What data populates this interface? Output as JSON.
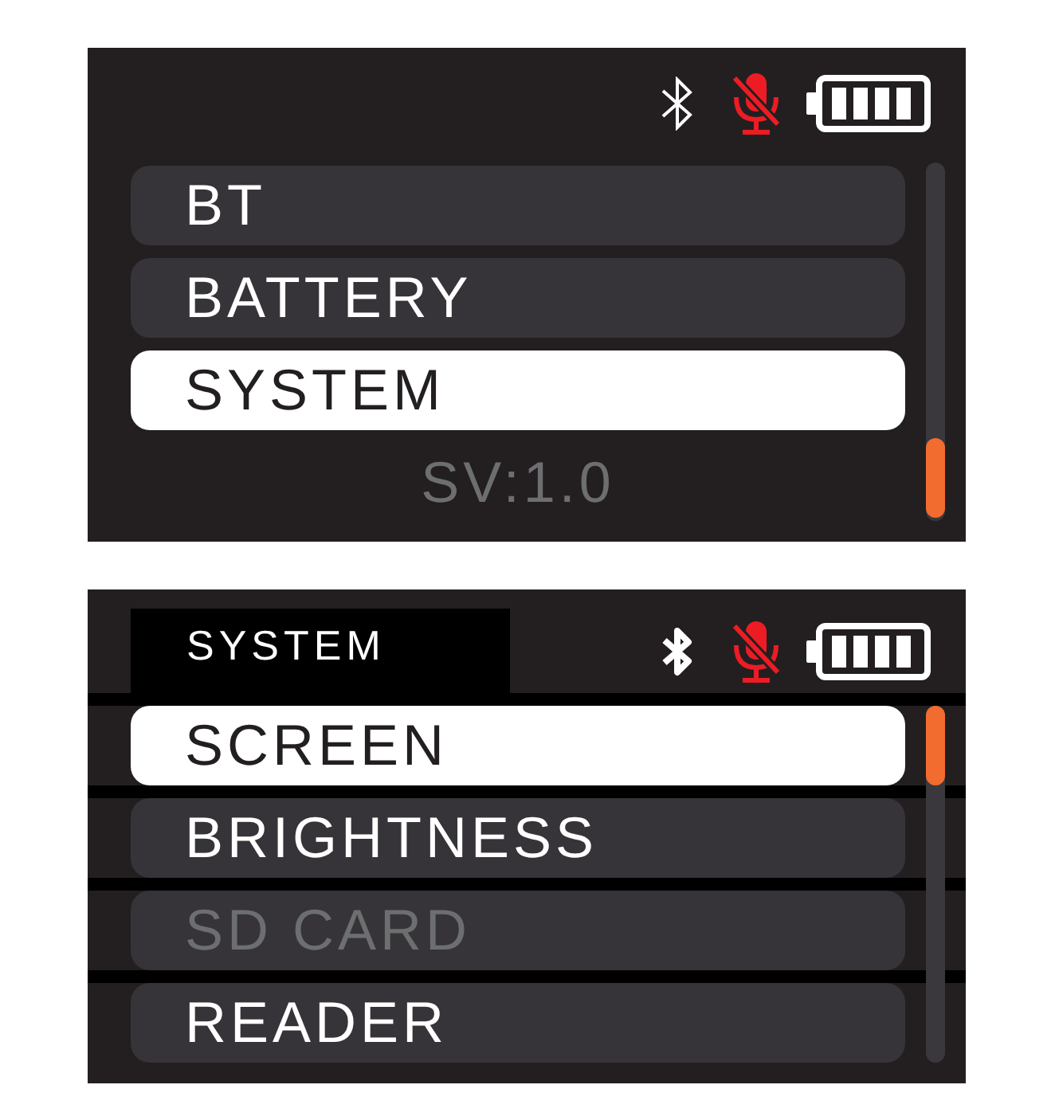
{
  "main_screen": {
    "menu": [
      {
        "label": "BT",
        "selected": false,
        "disabled": false
      },
      {
        "label": "BATTERY",
        "selected": false,
        "disabled": false
      },
      {
        "label": "SYSTEM",
        "selected": true,
        "disabled": false
      }
    ],
    "version": "SV:1.0"
  },
  "system_screen": {
    "title": "SYSTEM",
    "menu": [
      {
        "label": "SCREEN",
        "selected": true,
        "disabled": false
      },
      {
        "label": "BRIGHTNESS",
        "selected": false,
        "disabled": false
      },
      {
        "label": "SD CARD",
        "selected": false,
        "disabled": true
      },
      {
        "label": "READER",
        "selected": false,
        "disabled": false
      }
    ]
  }
}
